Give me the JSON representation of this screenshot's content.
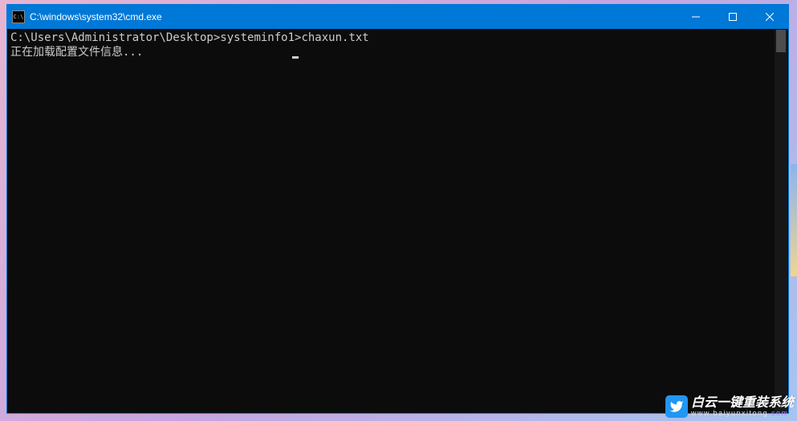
{
  "window": {
    "title": "C:\\windows\\system32\\cmd.exe",
    "icon_label": "C:\\"
  },
  "terminal": {
    "prompt": "C:\\Users\\Administrator\\Desktop>",
    "command": "systeminfo1>chaxun.txt",
    "status_line": "正在加载配置文件信息...",
    "cursor_padding": "                      "
  },
  "watermark": {
    "title": "白云一键重装系统",
    "url_prefix": "www.baiyunxitong",
    "url_suffix": ".com"
  }
}
